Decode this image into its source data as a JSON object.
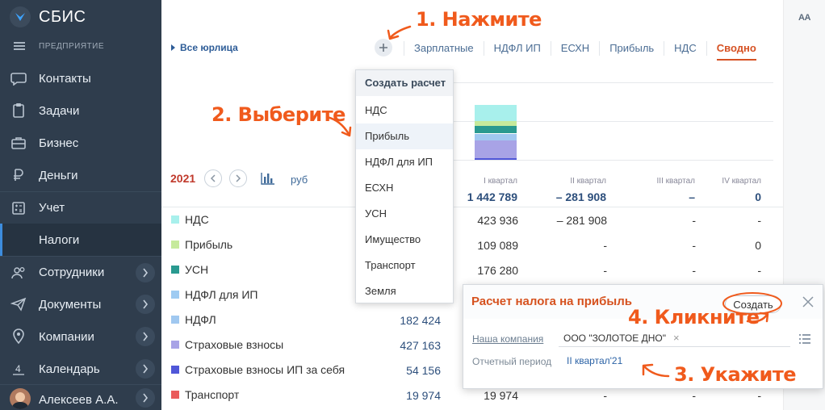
{
  "app": {
    "brand": "СБИС",
    "org_label": "ПРЕДПРИЯТИЕ"
  },
  "sidebar": {
    "items": [
      {
        "label": "Контакты",
        "icon": "chat-icon"
      },
      {
        "label": "Задачи",
        "icon": "task-icon"
      },
      {
        "label": "Бизнес",
        "icon": "briefcase-icon"
      },
      {
        "label": "Деньги",
        "icon": "ruble-icon"
      },
      {
        "label": "Учет",
        "icon": "calculator-icon"
      },
      {
        "label": "Налоги",
        "icon": "",
        "active": true
      },
      {
        "label": "Сотрудники",
        "icon": "people-icon"
      },
      {
        "label": "Документы",
        "icon": "paper-plane-icon"
      },
      {
        "label": "Компании",
        "icon": "location-icon"
      },
      {
        "label": "Календарь",
        "icon": "calendar-icon",
        "day": "4"
      },
      {
        "label": "Алексеев А.А.",
        "icon": "avatar"
      }
    ]
  },
  "header": {
    "all_legal": "Все юрлица",
    "tabs": [
      "Зарплатные",
      "НДФЛ ИП",
      "ЕСХН",
      "Прибыль",
      "НДС",
      "Сводно"
    ],
    "active_tab": "Сводно"
  },
  "period": {
    "year": "2021",
    "currency": "руб"
  },
  "quarters": {
    "headers": [
      "I квартал",
      "II квартал",
      "III квартал",
      "IV квартал"
    ],
    "totals": [
      "1 442 789",
      "– 281 908",
      "–",
      "0"
    ]
  },
  "rows": [
    {
      "name": "НДС",
      "color": "#a8f0ec",
      "total": "",
      "q": [
        "423 936",
        "– 281 908",
        "-",
        "-"
      ]
    },
    {
      "name": "Прибыль",
      "color": "#c6ea9c",
      "total": "",
      "q": [
        "109 089",
        "-",
        "-",
        "0"
      ]
    },
    {
      "name": "УСН",
      "color": "#2a9a90",
      "total": "",
      "q": [
        "176 280",
        "-",
        "-",
        "-"
      ]
    },
    {
      "name": "НДФЛ для ИП",
      "color": "#9ecbf2",
      "total": "",
      "q": [
        "",
        "",
        "",
        ""
      ]
    },
    {
      "name": "НДФЛ",
      "color": "#a0c8f0",
      "total": "182 424",
      "q": [
        "",
        "",
        "",
        ""
      ]
    },
    {
      "name": "Страховые взносы",
      "color": "#a8a3e6",
      "total": "427 163",
      "q": [
        "",
        "",
        "",
        ""
      ]
    },
    {
      "name": "Страховые взносы ИП за себя",
      "color": "#5057d8",
      "total": "54 156",
      "q": [
        "",
        "",
        "",
        ""
      ]
    },
    {
      "name": "Транспорт",
      "color": "#ea5b5b",
      "total": "19 974",
      "q": [
        "19 974",
        "-",
        "-",
        "-"
      ]
    }
  ],
  "dropdown": {
    "title": "Создать расчет",
    "items": [
      "НДС",
      "Прибыль",
      "НДФЛ для ИП",
      "ЕСХН",
      "УСН",
      "Имущество",
      "Транспорт",
      "Земля"
    ],
    "highlighted": "Прибыль"
  },
  "popup": {
    "title": "Расчет налога на прибыль",
    "create_label": "Создать",
    "company_label": "Наша компания",
    "company_value": "ООО \"ЗОЛОТОЕ ДНО\"",
    "period_label": "Отчетный период",
    "period_value": "II квартал'21"
  },
  "rail": {
    "font_toggle": "АА"
  },
  "callouts": {
    "step1": "1. Нажмите",
    "step2": "2. Выберите",
    "step3": "3. Укажите",
    "step4": "4. Кликните"
  },
  "colors": {
    "sidebar_bg": "#2f3d4d",
    "accent_orange": "#d65224",
    "callout_orange": "#f05a1c",
    "link_blue": "#2d5c97"
  }
}
